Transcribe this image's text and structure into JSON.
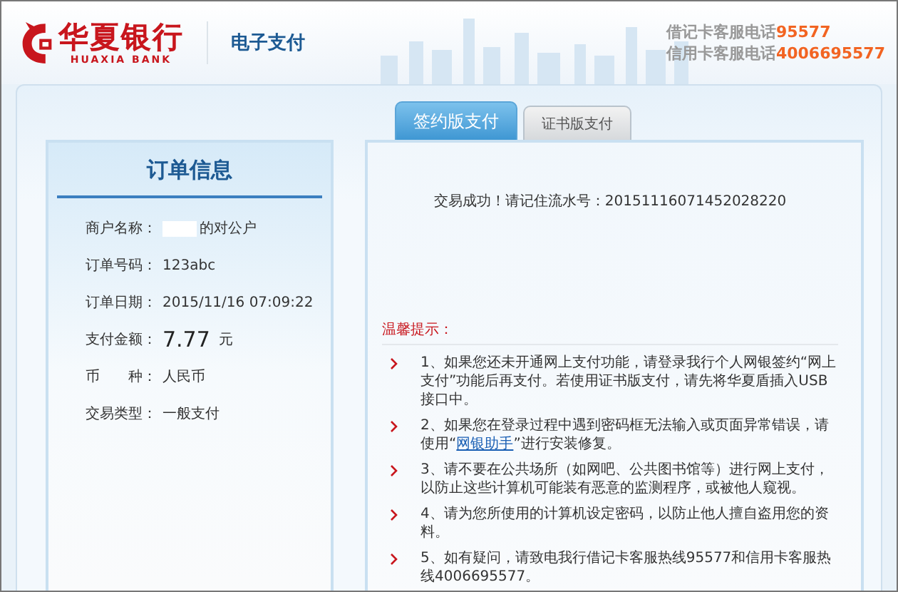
{
  "header": {
    "bank_name": "华夏银行",
    "bank_name_en": "HUAXIA BANK",
    "section": "电子支付",
    "hotlines": [
      {
        "label": "借记卡客服电话",
        "number": "95577"
      },
      {
        "label": "信用卡客服电话",
        "number": "4006695577"
      }
    ]
  },
  "tabs": [
    {
      "label": "签约版支付",
      "selected": true
    },
    {
      "label": "证书版支付",
      "selected": false
    }
  ],
  "order": {
    "title": "订单信息",
    "fields": [
      {
        "label": "商户名称：",
        "value": "的对公户",
        "kind": "redacted"
      },
      {
        "label": "订单号码：",
        "value": "123abc",
        "kind": "text"
      },
      {
        "label": "订单日期：",
        "value": "2015/11/16 07:09:22",
        "kind": "text"
      },
      {
        "label": "支付金额：",
        "value": "7.77",
        "unit": "元",
        "kind": "amount"
      },
      {
        "label": "币　　种：",
        "value": "人民币",
        "kind": "text"
      },
      {
        "label": "交易类型：",
        "value": "一般支付",
        "kind": "text"
      }
    ]
  },
  "result": {
    "message": "交易成功！请记住流水号：20151116071452028220"
  },
  "tips": {
    "title": "温馨提示：",
    "items": [
      {
        "segments": [
          {
            "kind": "text",
            "text": "1、如果您还未开通网上支付功能，请登录我行个人网银签约“网上支付”功能后再支付。若使用证书版支付，请先将华夏盾插入USB接口中。"
          }
        ]
      },
      {
        "segments": [
          {
            "kind": "text",
            "text": "2、如果您在登录过程中遇到密码框无法输入或页面异常错误，请使用“"
          },
          {
            "kind": "link",
            "text": "网银助手"
          },
          {
            "kind": "text",
            "text": "”进行安装修复。"
          }
        ]
      },
      {
        "segments": [
          {
            "kind": "text",
            "text": "3、请不要在公共场所（如网吧、公共图书馆等）进行网上支付，以防止这些计算机可能装有恶意的监测程序，或被他人窥视。"
          }
        ]
      },
      {
        "segments": [
          {
            "kind": "text",
            "text": "4、请为您所使用的计算机设定密码，以防止他人擅自盗用您的资料。"
          }
        ]
      },
      {
        "segments": [
          {
            "kind": "text",
            "text": "5、如有疑问，请致电我行借记卡客服热线95577和信用卡客服热线4006695577。"
          }
        ]
      }
    ]
  }
}
